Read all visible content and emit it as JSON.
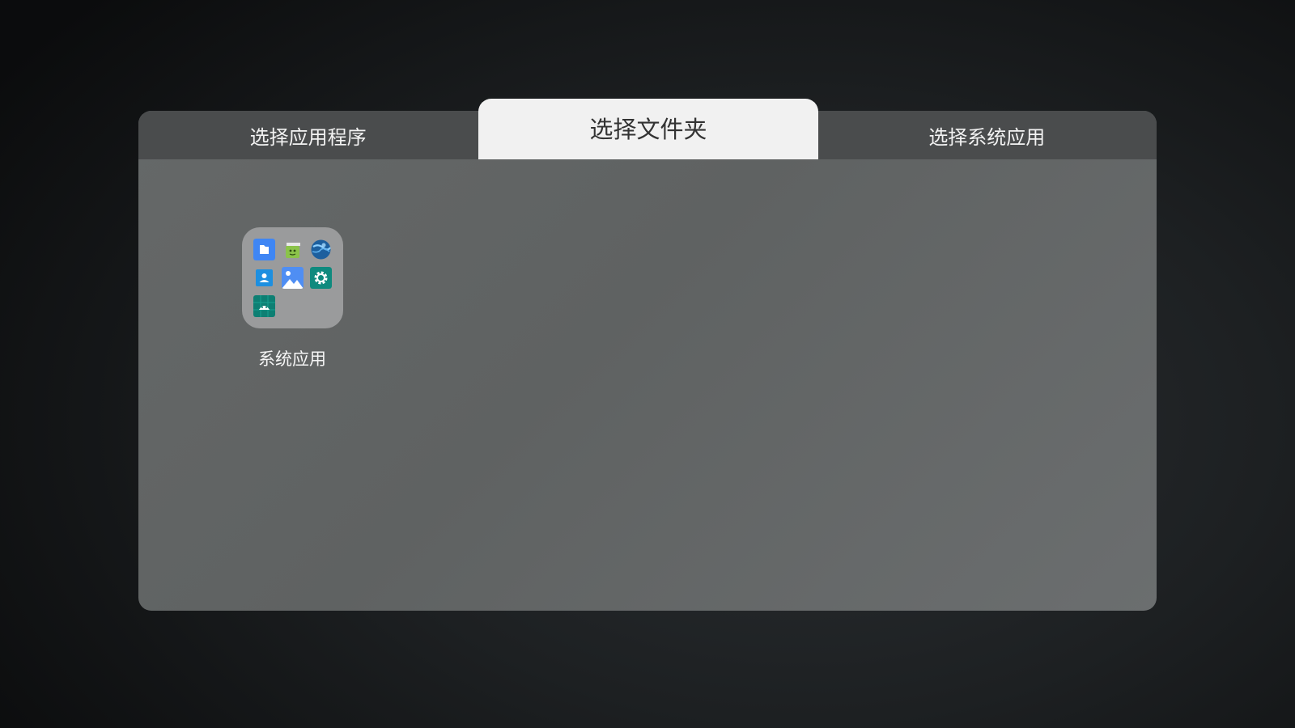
{
  "tabs": [
    {
      "label": "选择应用程序",
      "active": false
    },
    {
      "label": "选择文件夹",
      "active": true
    },
    {
      "label": "选择系统应用",
      "active": false
    }
  ],
  "folder": {
    "label": "系统应用",
    "apps": [
      "files-icon",
      "store-icon",
      "browser-icon",
      "contacts-icon",
      "gallery-icon",
      "settings-icon",
      "android-icon"
    ]
  },
  "colors": {
    "tab_bar": "#4a4c4d",
    "active_tab": "#f1f1f1",
    "panel": "#636666",
    "folder_bg": "#9a9b9c"
  }
}
